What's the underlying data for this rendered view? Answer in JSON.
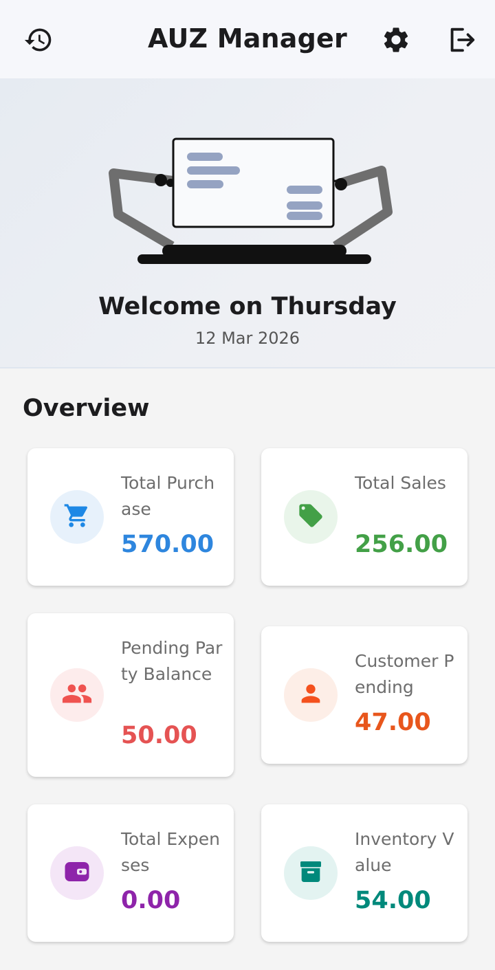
{
  "app": {
    "title": "AUZ Manager"
  },
  "icons": {
    "history": "history-icon",
    "settings": "gear-icon",
    "logout": "logout-icon"
  },
  "hero": {
    "welcome": "Welcome on Thursday",
    "date": "12 Mar 2026"
  },
  "overview": {
    "title": "Overview",
    "cards": [
      {
        "label": "Total Purchase",
        "value": "570.00",
        "color": "#2e86de",
        "bg": "#e7f1fb",
        "icon": "cart-icon"
      },
      {
        "label": "Total Sales",
        "value": "256.00",
        "color": "#43a047",
        "bg": "#e9f5ea",
        "icon": "tag-icon"
      },
      {
        "label": "Pending Party Balance",
        "value": "50.00",
        "color": "#e55353",
        "bg": "#fdecec",
        "icon": "group-icon"
      },
      {
        "label": "Customer Pending",
        "value": "47.00",
        "color": "#e8561c",
        "bg": "#fdeee7",
        "icon": "person-icon"
      },
      {
        "label": "Total Expenses",
        "value": "0.00",
        "color": "#8e24aa",
        "bg": "#f4e6f7",
        "icon": "wallet-icon"
      },
      {
        "label": "Inventory Value",
        "value": "54.00",
        "color": "#00897b",
        "bg": "#e3f3f1",
        "icon": "archive-icon"
      }
    ]
  }
}
